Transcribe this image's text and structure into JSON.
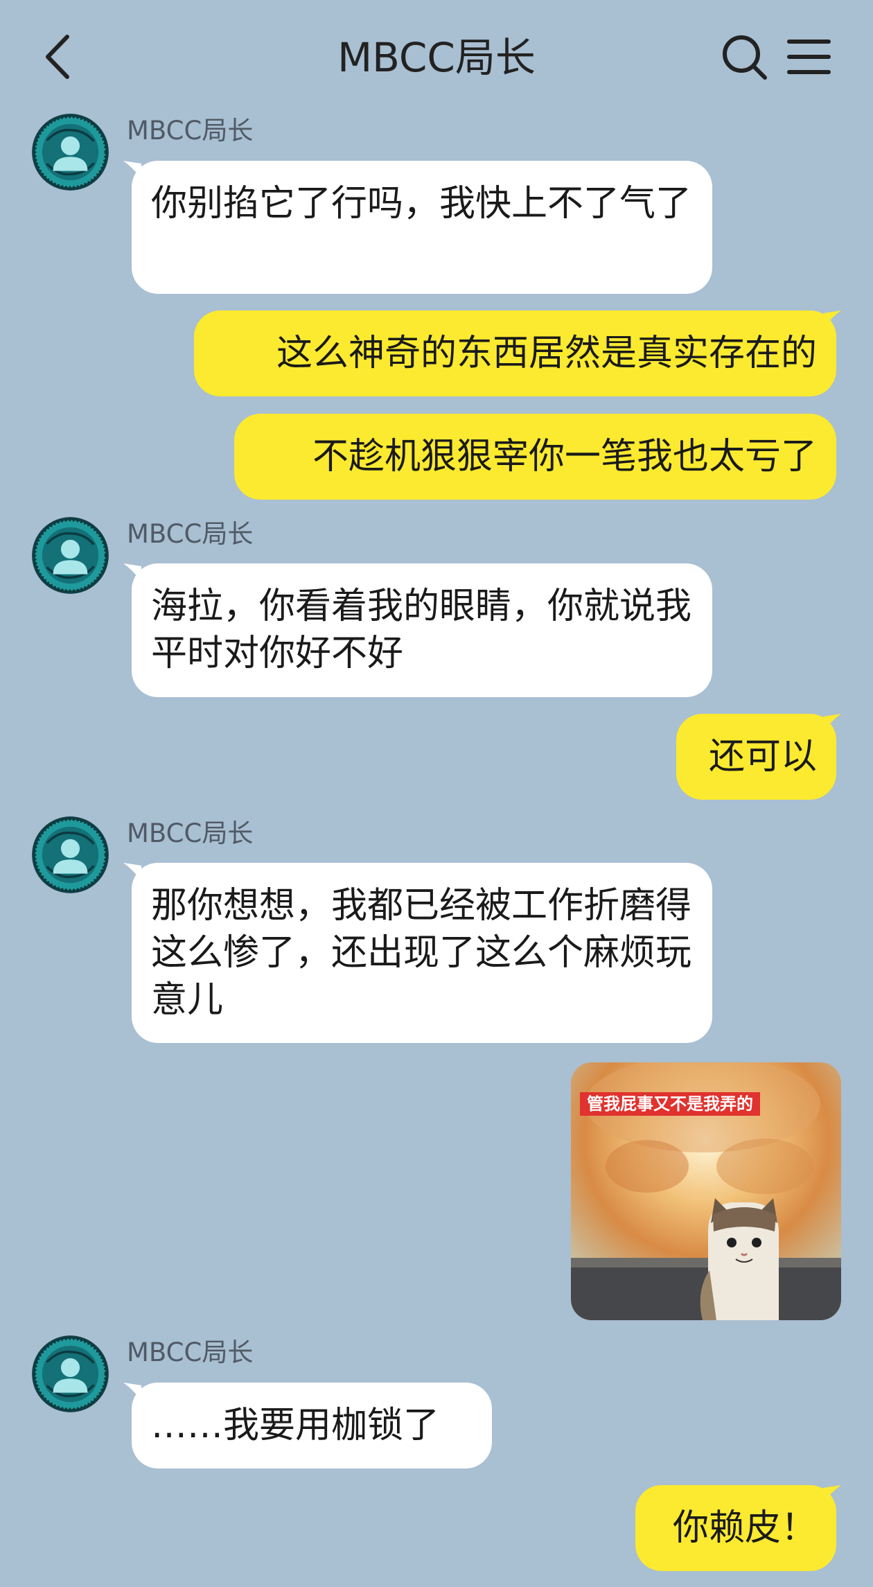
{
  "header": {
    "title": "MBCC局长",
    "back_icon": "chevron-left-icon",
    "search_icon": "search-icon",
    "menu_icon": "hamburger-menu-icon"
  },
  "colors": {
    "background": "#a9bfd2",
    "incoming_bubble": "#ffffff",
    "outgoing_bubble": "#fbea2f",
    "avatar_ring": "#1e9a9a"
  },
  "messages": [
    {
      "direction": "incoming",
      "sender": "MBCC局长",
      "text": "你别掐它了行吗，我快上不了气了"
    },
    {
      "direction": "outgoing",
      "text": "这么神奇的东西居然是真实存在的"
    },
    {
      "direction": "outgoing",
      "text": "不趁机狠狠宰你一笔我也太亏了"
    },
    {
      "direction": "incoming",
      "sender": "MBCC局长",
      "text": "海拉，你看着我的眼睛，你就说我平时对你好不好"
    },
    {
      "direction": "outgoing",
      "text": "还可以"
    },
    {
      "direction": "incoming",
      "sender": "MBCC局长",
      "text": "那你想想，我都已经被工作折磨得这么惨了，还出现了这么个麻烦玩意儿"
    },
    {
      "direction": "outgoing",
      "type": "sticker",
      "caption": "管我屁事又不是我弄的"
    },
    {
      "direction": "incoming",
      "sender": "MBCC局长",
      "text": "……我要用枷锁了"
    },
    {
      "direction": "outgoing",
      "text": "你赖皮！"
    }
  ]
}
